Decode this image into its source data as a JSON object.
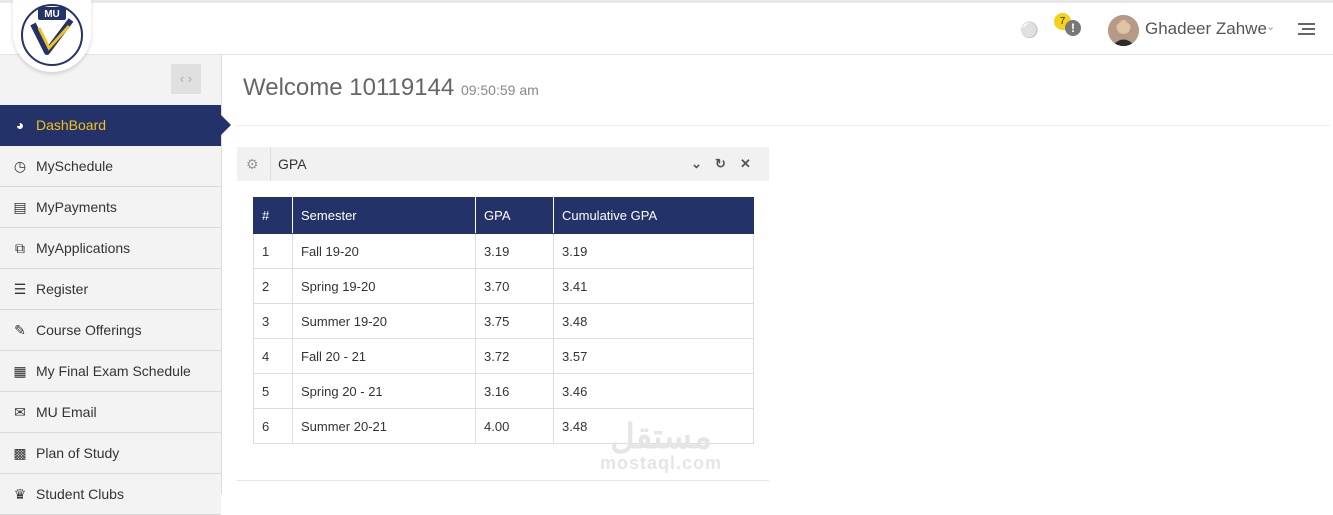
{
  "header": {
    "logo_text": "MU",
    "notification_count": "7",
    "alert_glyph": "!",
    "user_name": "Ghadeer Zahwe"
  },
  "sidebar": {
    "items": [
      {
        "label": "DashBoard",
        "icon": "dashboard-icon",
        "active": true
      },
      {
        "label": "MySchedule",
        "icon": "clock-icon"
      },
      {
        "label": "MyPayments",
        "icon": "money-icon"
      },
      {
        "label": "MyApplications",
        "icon": "copy-icon"
      },
      {
        "label": "Register",
        "icon": "list-icon"
      },
      {
        "label": "Course Offerings",
        "icon": "edit-icon"
      },
      {
        "label": "My Final Exam Schedule",
        "icon": "calendar-icon"
      },
      {
        "label": "MU Email",
        "icon": "envelope-icon"
      },
      {
        "label": "Plan of Study",
        "icon": "list-alt-icon"
      },
      {
        "label": "Student Clubs",
        "icon": "trophy-icon"
      }
    ]
  },
  "main": {
    "welcome": "Welcome 10119144",
    "time": "09:50:59 am",
    "portlet": {
      "title": "GPA",
      "columns": [
        "#",
        "Semester",
        "GPA",
        "Cumulative GPA"
      ],
      "rows": [
        [
          "1",
          "Fall 19-20",
          "3.19",
          "3.19"
        ],
        [
          "2",
          "Spring 19-20",
          "3.70",
          "3.41"
        ],
        [
          "3",
          "Summer 19-20",
          "3.75",
          "3.48"
        ],
        [
          "4",
          "Fall 20 - 21",
          "3.72",
          "3.57"
        ],
        [
          "5",
          "Spring 20 - 21",
          "3.16",
          "3.46"
        ],
        [
          "6",
          "Summer 20-21",
          "4.00",
          "3.48"
        ]
      ]
    }
  },
  "watermark": {
    "arabic": "مستقل",
    "latin": "mostaql.com"
  },
  "colors": {
    "brand_navy": "#233268",
    "active_text": "#f3c21b",
    "badge": "#f5d21a"
  }
}
